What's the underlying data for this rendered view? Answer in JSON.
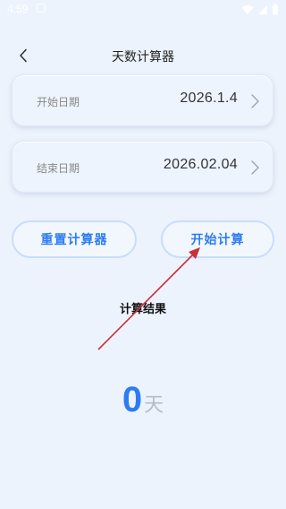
{
  "status_bar": {
    "time": "4:59"
  },
  "header": {
    "title": "天数计算器"
  },
  "start_date": {
    "label": "开始日期",
    "value": "2026.1.4"
  },
  "end_date": {
    "label": "结束日期",
    "value": "2026.02.04"
  },
  "actions": {
    "reset_label": "重置计算器",
    "start_label": "开始计算"
  },
  "result": {
    "title": "计算结果",
    "value": "0",
    "unit": "天"
  },
  "colors": {
    "background": "#edf3fc",
    "accent": "#2d7cf2",
    "annotation": "#c8303a"
  }
}
